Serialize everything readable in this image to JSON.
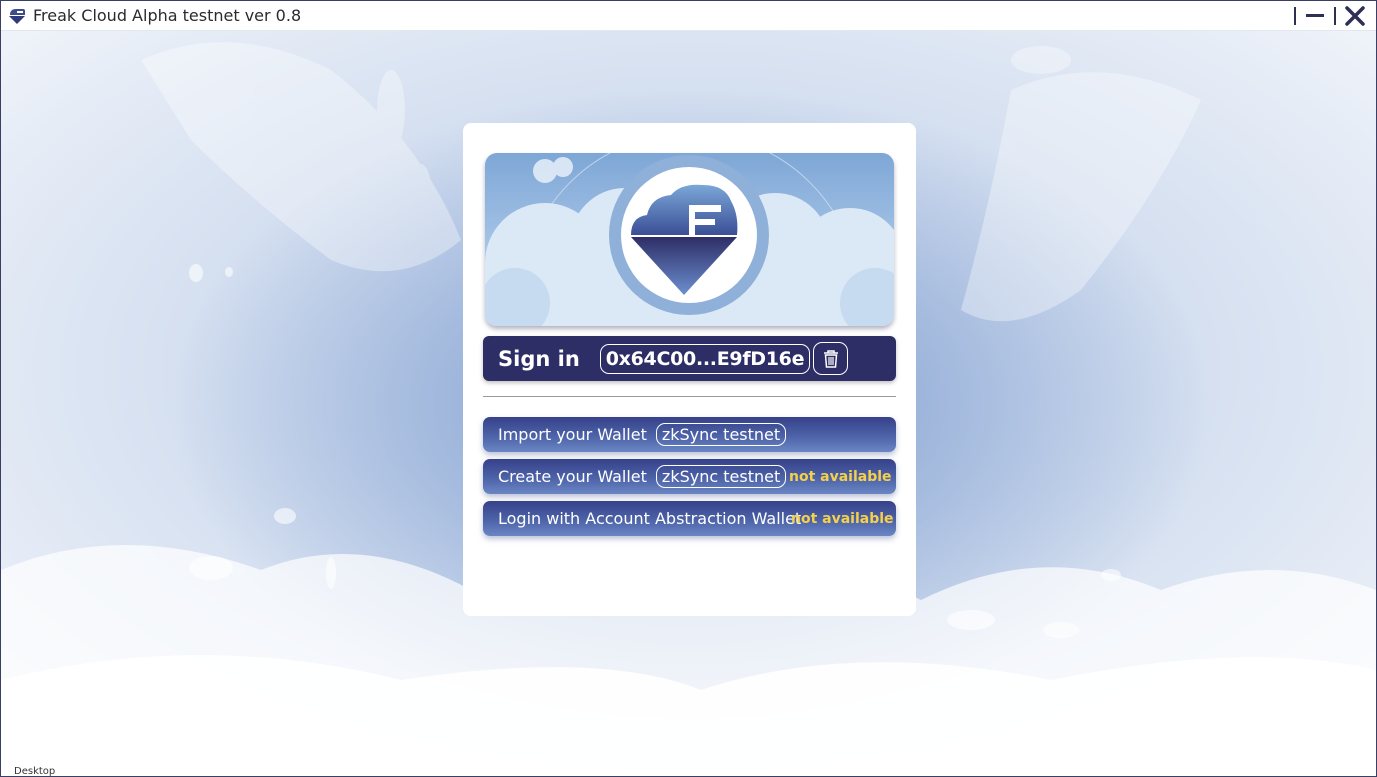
{
  "window": {
    "title": "Freak Cloud Alpha testnet ver 0.8"
  },
  "signin": {
    "label": "Sign in",
    "address": "0x64C00...E9fD16e"
  },
  "options": [
    {
      "label": "Import your Wallet",
      "network": "zkSync testnet",
      "status": ""
    },
    {
      "label": "Create your Wallet",
      "network": "zkSync testnet",
      "status": "not available"
    },
    {
      "label": "Login with Account Abstraction Wallet",
      "network": "",
      "status": "not available"
    }
  ],
  "desktop_peek": "Desktop",
  "icons": {
    "app": "freak-cloud-logo-icon",
    "minimize": "minimize-icon",
    "close": "close-icon",
    "trash": "trash-icon"
  },
  "colors": {
    "accent_dark": "#2e2e66",
    "button_gradient_top": "#36418a",
    "button_gradient_bottom": "#6a86c4",
    "not_available": "#f5d04a"
  }
}
